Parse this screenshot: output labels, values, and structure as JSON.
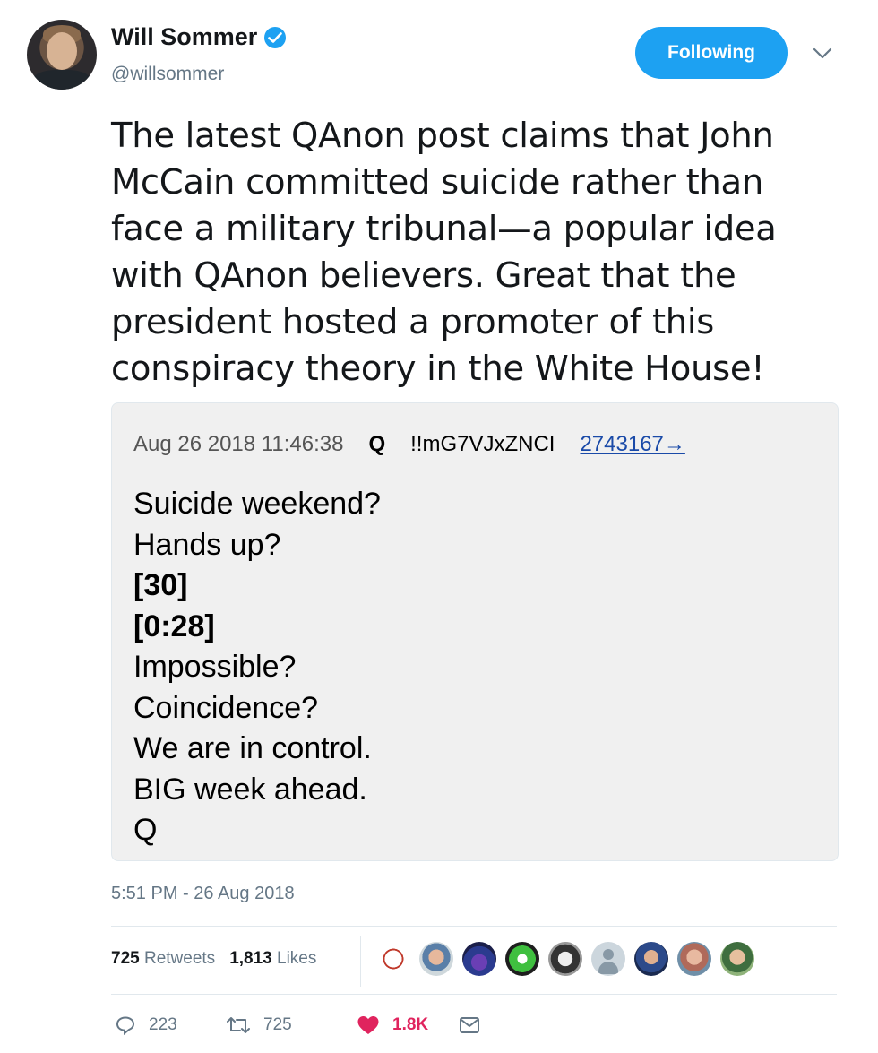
{
  "user": {
    "name": "Will Sommer",
    "handle": "@willsommer",
    "follow_label": "Following"
  },
  "tweet": {
    "text": "The latest QAnon post claims that John McCain committed suicide rather than face a military tribunal—a popular idea with QAnon believers. Great that the president hosted a promoter of this conspiracy theory in the White House!"
  },
  "card": {
    "date": "Aug 26 2018 11:46:38",
    "author": "Q",
    "trip": "!!mG7VJxZNCI",
    "post_link": "2743167→",
    "lines": [
      "Suicide weekend?",
      "Hands up?",
      "[30]",
      "[0:28]",
      "Impossible?",
      "Coincidence?",
      "We are in control.",
      "BIG week ahead.",
      "Q"
    ]
  },
  "timestamp": "5:51 PM - 26 Aug 2018",
  "stats": {
    "retweets_count": "725",
    "retweets_label": "Retweets",
    "likes_count": "1,813",
    "likes_label": "Likes"
  },
  "actions": {
    "replies": "223",
    "retweets": "725",
    "likes": "1.8K"
  },
  "colors": {
    "accent": "#1da1f2",
    "like": "#e0245e",
    "muted": "#657786"
  },
  "icons": [
    "verified-badge-icon",
    "chevron-down-icon",
    "reply-icon",
    "retweet-icon",
    "heart-icon",
    "message-icon"
  ]
}
